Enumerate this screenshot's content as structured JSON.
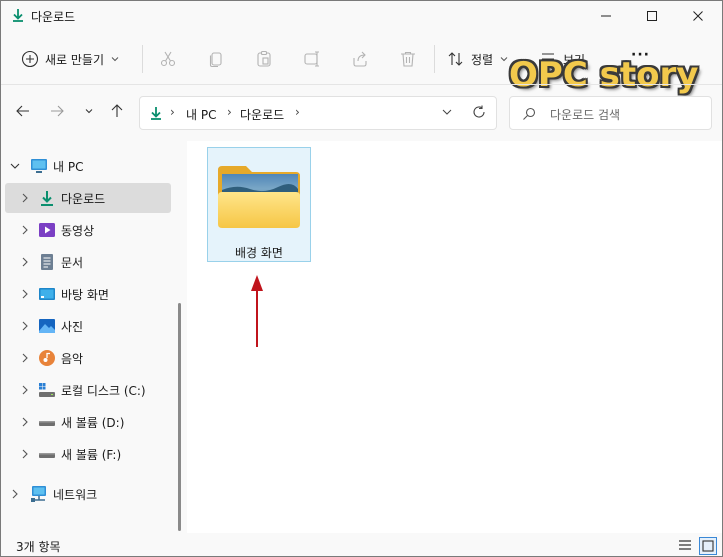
{
  "window": {
    "title": "다운로드"
  },
  "toolbar": {
    "new_label": "새로 만들기",
    "sort_label": "정렬",
    "view_label": "보기",
    "more_label": "···"
  },
  "watermark": "OPC story",
  "address": {
    "crumbs": [
      "내 PC",
      "다운로드"
    ]
  },
  "search": {
    "placeholder": "다운로드 검색"
  },
  "sidebar": {
    "items": [
      {
        "label": "내 PC",
        "icon": "monitor-icon"
      },
      {
        "label": "다운로드",
        "icon": "download-icon"
      },
      {
        "label": "동영상",
        "icon": "video-icon"
      },
      {
        "label": "문서",
        "icon": "document-icon"
      },
      {
        "label": "바탕 화면",
        "icon": "desktop-icon"
      },
      {
        "label": "사진",
        "icon": "pictures-icon"
      },
      {
        "label": "음악",
        "icon": "music-icon"
      },
      {
        "label": "로컬 디스크 (C:)",
        "icon": "windows-drive-icon"
      },
      {
        "label": "새 볼륨 (D:)",
        "icon": "drive-icon"
      },
      {
        "label": "새 볼륨 (F:)",
        "icon": "drive-icon"
      },
      {
        "label": "네트워크",
        "icon": "network-icon"
      }
    ]
  },
  "content": {
    "items": [
      {
        "label": "배경 화면",
        "icon": "folder-icon"
      }
    ]
  },
  "status": {
    "item_count": "3개 항목"
  },
  "colors": {
    "accent": "#0a8f6e",
    "selection": "#e5f3fb",
    "selection_border": "#99d1ea",
    "arrow": "#c0141c"
  }
}
